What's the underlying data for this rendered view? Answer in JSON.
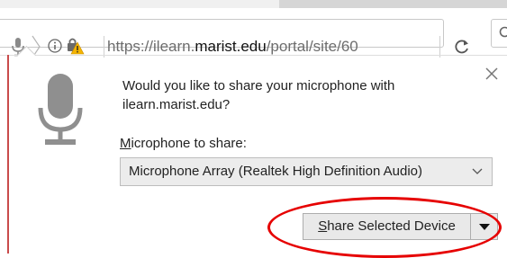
{
  "toolbar": {
    "url_prefix": "https://ilearn.",
    "url_domain": "marist.edu",
    "url_path": "/portal/site/60",
    "icons": [
      "microphone-icon",
      "chevron-right-icon",
      "info-icon",
      "lock-warning-icon",
      "reload-icon",
      "search-icon"
    ]
  },
  "dialog": {
    "question": "Would you like to share your microphone with ilearn.marist.edu?",
    "share_label_key": "M",
    "share_label_rest": "icrophone to share:",
    "selected_device": "Microphone Array (Realtek High Definition Audio)",
    "share_button_key": "S",
    "share_button_rest": "hare Selected Device",
    "icons": [
      "microphone-large-icon",
      "close-icon",
      "dropdown-arrow-icon"
    ]
  },
  "colors": {
    "annotation_ellipse": "#e60000",
    "page_left_border": "#c94b4b",
    "select_background": "#ececec",
    "button_background": "#e9e9e9"
  }
}
